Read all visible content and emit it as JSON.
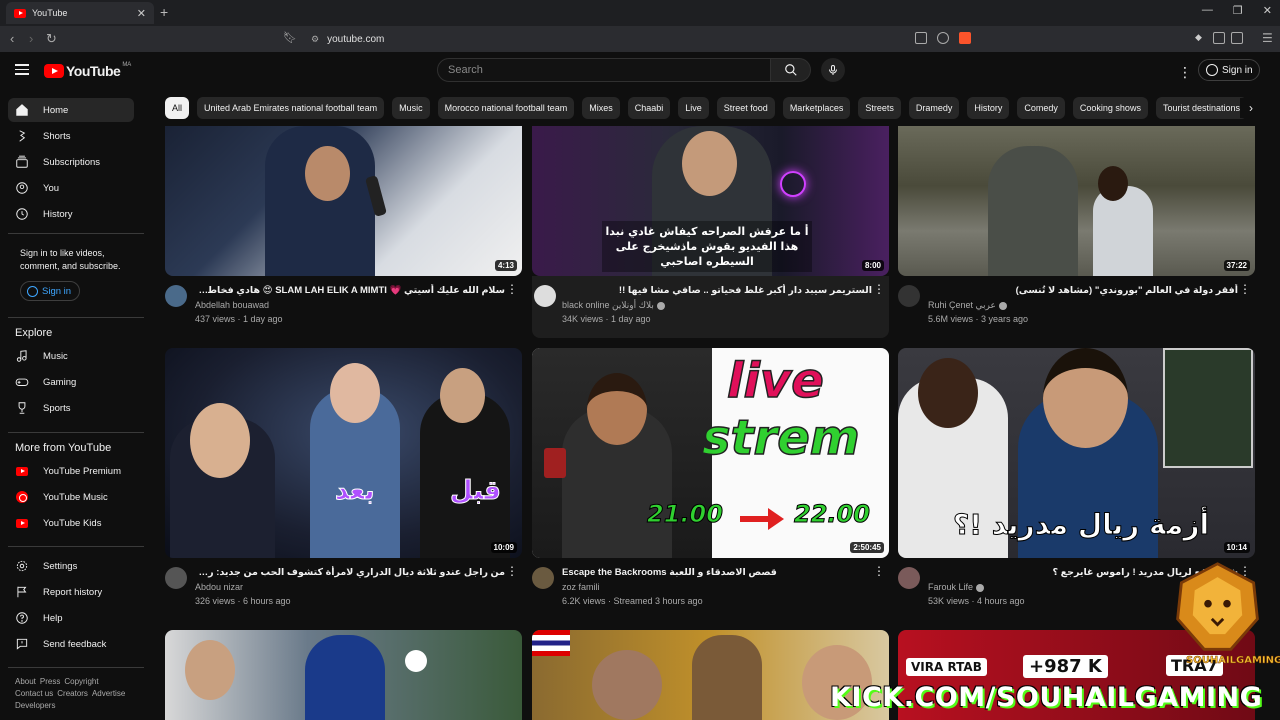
{
  "browser": {
    "tab_title": "YouTube",
    "url": "youtube.com"
  },
  "header": {
    "logo_text": "YouTube",
    "country_code": "MA",
    "search_placeholder": "Search",
    "sign_in": "Sign in"
  },
  "sidebar": {
    "main": [
      {
        "label": "Home",
        "icon": "home-icon"
      },
      {
        "label": "Shorts",
        "icon": "shorts-icon"
      },
      {
        "label": "Subscriptions",
        "icon": "subscriptions-icon"
      },
      {
        "label": "You",
        "icon": "you-icon"
      },
      {
        "label": "History",
        "icon": "history-icon"
      }
    ],
    "signin_note": "Sign in to like videos, comment, and subscribe.",
    "signin_button": "Sign in",
    "explore_title": "Explore",
    "explore": [
      {
        "label": "Music",
        "icon": "music-icon"
      },
      {
        "label": "Gaming",
        "icon": "gaming-icon"
      },
      {
        "label": "Sports",
        "icon": "sports-icon"
      }
    ],
    "more_title": "More from YouTube",
    "more": [
      {
        "label": "YouTube Premium",
        "icon": "youtube-premium-icon"
      },
      {
        "label": "YouTube Music",
        "icon": "youtube-music-icon"
      },
      {
        "label": "YouTube Kids",
        "icon": "youtube-kids-icon"
      }
    ],
    "settings": [
      {
        "label": "Settings",
        "icon": "gear-icon"
      },
      {
        "label": "Report history",
        "icon": "flag-icon"
      },
      {
        "label": "Help",
        "icon": "help-icon"
      },
      {
        "label": "Send feedback",
        "icon": "feedback-icon"
      }
    ],
    "footer": [
      "About",
      "Press",
      "Copyright",
      "Contact us",
      "Creators",
      "Advertise",
      "Developers"
    ]
  },
  "chips": [
    "All",
    "United Arab Emirates national football team",
    "Music",
    "Morocco national football team",
    "Mixes",
    "Chaabi",
    "Live",
    "Street food",
    "Marketplaces",
    "Streets",
    "Dramedy",
    "History",
    "Comedy",
    "Cooking shows",
    "Tourist destinations"
  ],
  "videos": [
    {
      "title": "سلام الله عليك أسيتي 💗 SLAM LAH ELIK A MIMTI 😍 هادي فخاطر لميمات 🥀",
      "channel": "Abdellah bouawad",
      "stats": "437 views · 1 day ago",
      "duration": "4:13"
    },
    {
      "title": "الستريمر سيبد دار أكبر غلط فحياتو .. صافي مشا فيها !!",
      "channel": "black online بلاك أونلاين",
      "stats": "34K views · 1 day ago",
      "duration": "8:00",
      "overlay": "أ ما عرفش الصراحه كيفاش غادي نبدا هذا الفيديو بقوش ماذشيخرج على السيطره اصاحبي"
    },
    {
      "title": "أفقر دولة في العالم \"بوروندي\" (مشاهد لا تُنسى)",
      "channel": "Ruhi Çenet عربي",
      "stats": "5.6M views · 3 years ago",
      "duration": "37:22"
    },
    {
      "title": "من راجل عندو ثلاثة ديال الدراري لامرأة كتشوف الحب من جديد: رحلة تحول غامضة ومفاجئة",
      "channel": "Abdou nizar",
      "stats": "326 views · 6 hours ago",
      "duration": "10:09",
      "overlay_left": "بعد",
      "overlay_right": "قبل"
    },
    {
      "title": "Escape the Backrooms قصص الاصدقاء و اللعبة",
      "channel": "zoz famili",
      "stats": "6.2K views · Streamed 3 hours ago",
      "duration": "2:50:45",
      "overlay_top": "live",
      "overlay_mid": "strem",
      "time_from": "21.00",
      "time_to": "22.00"
    },
    {
      "title": "شنو واقع لريال مدريد ! راموس غايرجع ؟",
      "channel": "Farouk Life",
      "stats": "53K views · 4 hours ago",
      "duration": "10:14",
      "overlay": "أزمة ريال مدريد !؟"
    }
  ],
  "row3": {
    "thumb3_text_a": "VIRA RTAB",
    "thumb3_text_b": "+987 K",
    "thumb3_text_c": "TRA7"
  },
  "watermark": {
    "kick_text": "KICK.COM/SOUHAILGAMING",
    "logo_text": "SOUHAILGAMING"
  },
  "colors": {
    "background": "#0f0f0f",
    "brand_red": "#ff0000",
    "link_blue": "#3ea6ff",
    "kick_green": "#53fc18"
  }
}
